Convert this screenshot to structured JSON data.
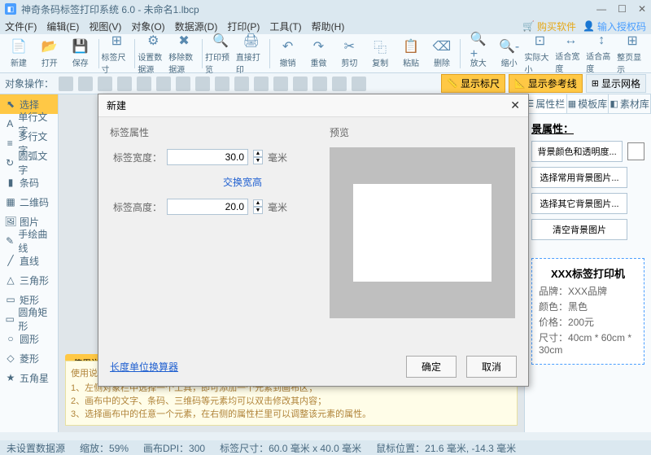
{
  "titlebar": {
    "title": "神奇条码标签打印系统 6.0 - 未命名1.lbcp"
  },
  "menubar": {
    "items": [
      "文件(F)",
      "编辑(E)",
      "视图(V)",
      "对象(O)",
      "数据源(D)",
      "打印(P)",
      "工具(T)",
      "帮助(H)"
    ],
    "buy": "购买软件",
    "auth": "输入授权码"
  },
  "toolbar1": [
    "新建",
    "打开",
    "保存",
    "标签尺寸",
    "设置数据源",
    "移除数据源",
    "打印预览",
    "直接打印",
    "撤销",
    "重做",
    "剪切",
    "复制",
    "粘贴",
    "删除",
    "放大",
    "缩小",
    "实际大小",
    "适合宽度",
    "适合高度",
    "整页显示"
  ],
  "toolbar1_icons": [
    "📄",
    "📂",
    "💾",
    "⊞",
    "⚙",
    "✖",
    "🔍",
    "🖨",
    "↶",
    "↷",
    "✂",
    "⿻",
    "📋",
    "⌫",
    "🔍+",
    "🔍-",
    "⊡",
    "↔",
    "↕",
    "⊞"
  ],
  "toolbar2": {
    "label": "对象操作：",
    "ruler": "显示标尺",
    "guides": "显示参考线",
    "grid": "显示网格"
  },
  "left_tools": [
    "选择",
    "单行文字",
    "多行文字",
    "圆弧文字",
    "条码",
    "二维码",
    "图片",
    "手绘曲线",
    "直线",
    "三角形",
    "矩形",
    "圆角矩形",
    "圆形",
    "菱形",
    "五角星"
  ],
  "left_icons": [
    "⬉",
    "A",
    "≡",
    "↻",
    "▮",
    "▦",
    "🖼",
    "✎",
    "╱",
    "△",
    "▭",
    "▭",
    "○",
    "◇",
    "★"
  ],
  "right_tabs": [
    "属性栏",
    "模板库",
    "素材库"
  ],
  "right_panel": {
    "title": "景属性：",
    "btns": [
      "背景颜色和透明度...",
      "选择常用背景图片...",
      "选择其它背景图片...",
      "清空背景图片"
    ]
  },
  "info_box": {
    "name": "XXX标签打印机",
    "brand_label": "品牌：",
    "brand": "XXX品牌",
    "color_label": "颜色：",
    "color": "黑色",
    "price_label": "价格：",
    "price": "200元",
    "size_label": "尺寸：",
    "size": "40cm * 60cm * 30cm"
  },
  "hint": {
    "tab": "使用说明",
    "title": "使用说明：",
    "l1": "1、左侧对象栏中选择一个工具，即可添加一个元素到画布区；",
    "l2": "2、画布中的文字、条码、三维码等元素均可以双击修改其内容；",
    "l3": "3、选择画布中的任意一个元素，在右侧的属性栏里可以调整该元素的属性。"
  },
  "dialog": {
    "title": "新建",
    "section_label": "标签属性",
    "preview_label": "预览",
    "width_label": "标签宽度：",
    "width_value": "30.0",
    "swap": "交换宽高",
    "height_label": "标签高度：",
    "height_value": "20.0",
    "unit": "毫米",
    "tool_link": "长度单位换算器",
    "ok": "确定",
    "cancel": "取消"
  },
  "statusbar": {
    "s1": "未设置数据源",
    "s2": "缩放：59%",
    "s3": "画布DPI：300",
    "s4": "标签尺寸：60.0 毫米 x 40.0 毫米",
    "s5": "鼠标位置：21.6 毫米,  -14.3 毫米"
  }
}
